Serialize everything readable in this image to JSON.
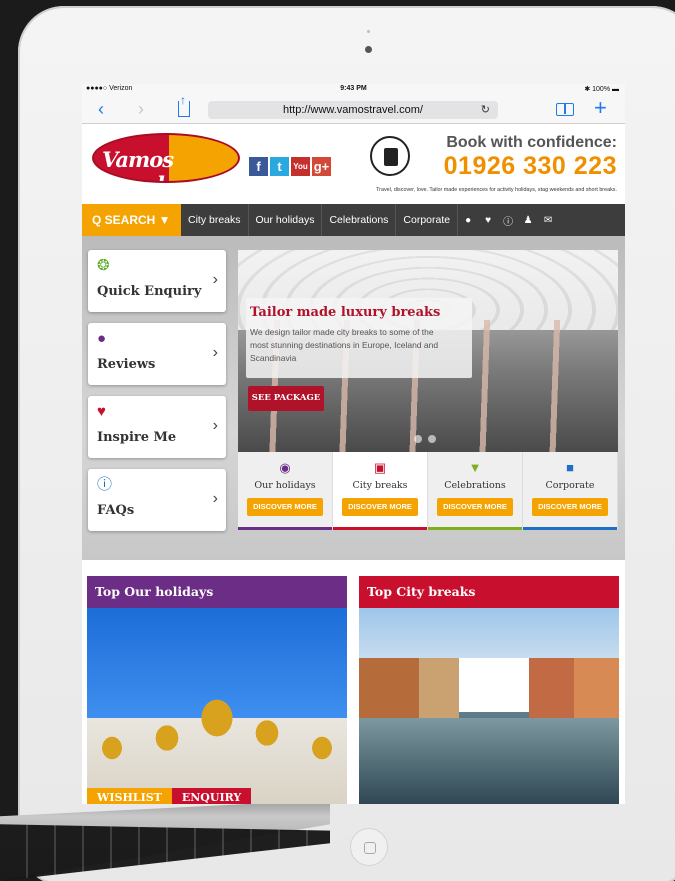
{
  "status": {
    "carrier": "●●●●○ Verizon ",
    "time": "9:43 PM",
    "battery": "✱ 100% ▬"
  },
  "browser": {
    "url": "http://www.vamostravel.com/"
  },
  "site": {
    "logo_text": "Vamos travel",
    "headline": "Book with confidence:",
    "phone": "01926 330 223",
    "tagline": "Travel, discover, love. Tailor made experiences for activity holidays, stag weekends and short breaks.",
    "social": [
      "f",
      "t",
      "You Tube",
      "g+"
    ]
  },
  "nav": {
    "search": "Q SEARCH ▼",
    "items": [
      "City breaks",
      "Our holidays",
      "Celebrations",
      "Corporate"
    ],
    "icons": [
      "speech-icon",
      "heart-icon",
      "info-icon",
      "user-icon",
      "mail-icon"
    ]
  },
  "side_cards": [
    {
      "label": "Quick Enquiry",
      "icon": "chat-icon",
      "color": "#5aa823"
    },
    {
      "label": "Reviews",
      "icon": "speech-bubble-icon",
      "color": "#6b2d86"
    },
    {
      "label": "Inspire Me",
      "icon": "heart-icon",
      "color": "#c8102e"
    },
    {
      "label": "FAQs",
      "icon": "info-icon",
      "color": "#1f6fc4"
    }
  ],
  "slide": {
    "title": "Tailor made luxury breaks",
    "text": "We design tailor made city breaks to some of the most stunning destinations in Europe, Iceland and Scandinavia",
    "button": "SEE PACKAGE"
  },
  "categories": [
    {
      "label": "Our holidays",
      "button": "DISCOVER MORE",
      "color": "#6b2d86"
    },
    {
      "label": "City breaks",
      "button": "DISCOVER MORE",
      "color": "#c8102e"
    },
    {
      "label": "Celebrations",
      "button": "DISCOVER MORE",
      "color": "#7fae1f"
    },
    {
      "label": "Corporate",
      "button": "DISCOVER MORE",
      "color": "#1f6fc4"
    }
  ],
  "panels": [
    {
      "title": "Top Our holidays",
      "color": "#6b2d86",
      "buttons": [
        "WISHLIST",
        "ENQUIRY"
      ]
    },
    {
      "title": "Top City breaks",
      "color": "#c8102e"
    }
  ]
}
